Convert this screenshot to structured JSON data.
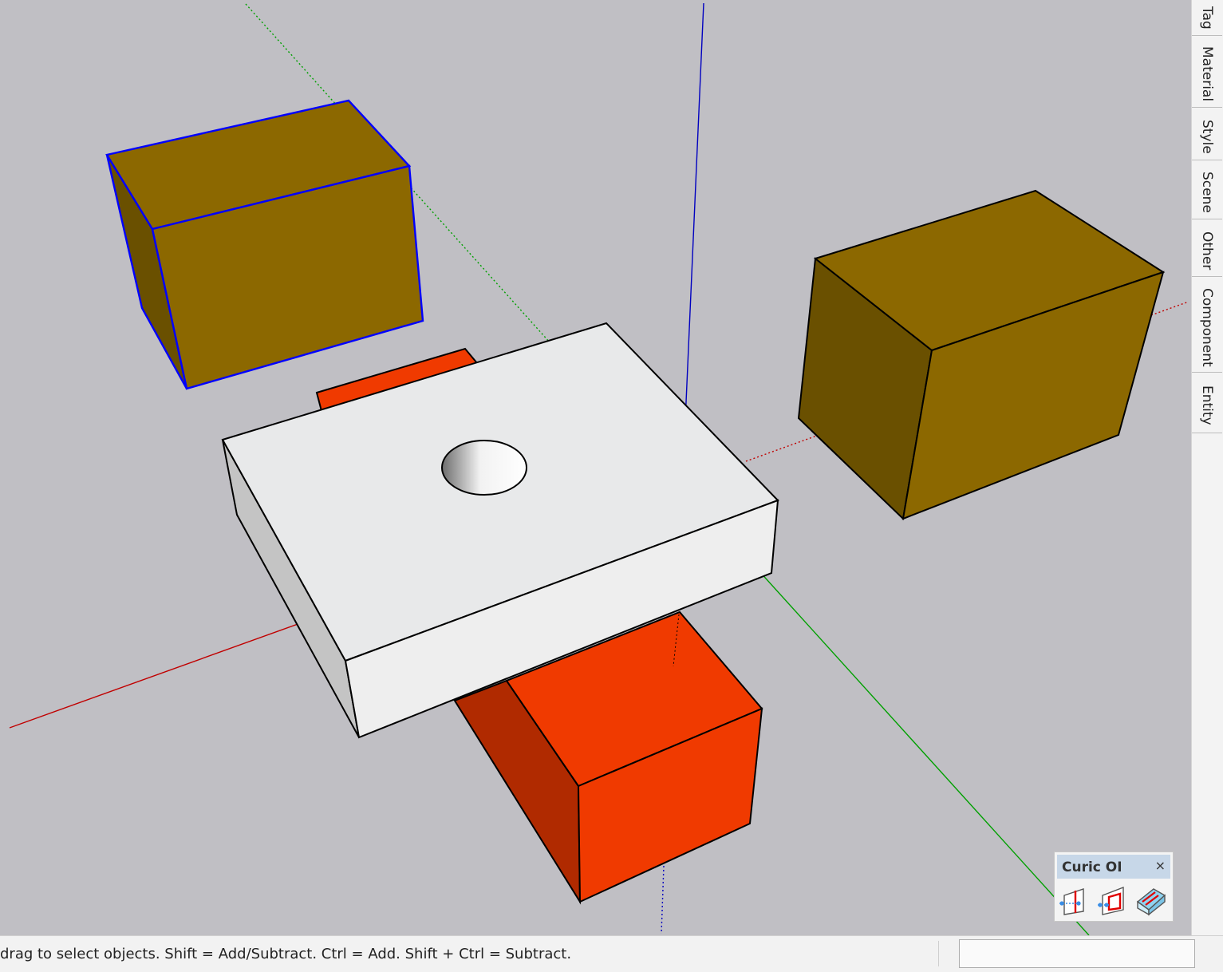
{
  "tray_tabs": [
    {
      "label": "Tag"
    },
    {
      "label": "Material"
    },
    {
      "label": "Style"
    },
    {
      "label": "Scene"
    },
    {
      "label": "Other"
    },
    {
      "label": "Component"
    },
    {
      "label": "Entity"
    }
  ],
  "status": {
    "hint": "drag to select objects. Shift = Add/Subtract. Ctrl = Add. Shift + Ctrl = Subtract.",
    "measurements_value": ""
  },
  "curic_panel": {
    "title": "Curic OI",
    "close_label": "×",
    "tools": [
      {
        "icon": "offset-edge-icon"
      },
      {
        "icon": "offset-face-icon"
      },
      {
        "icon": "offset-solid-icon"
      }
    ]
  },
  "colors": {
    "viewport_bg": "#c0bfc4",
    "box_gold_top": "#8c6800",
    "box_gold_side": "#6a5000",
    "box_orange_top": "#f03a00",
    "box_orange_side": "#b02a00",
    "slab_top": "#e8e9ea",
    "slab_side": "#c4c4c4",
    "axis_red": "#c00000",
    "axis_green": "#00a000",
    "axis_blue": "#0000c0",
    "selection_blue": "#0000ff"
  }
}
